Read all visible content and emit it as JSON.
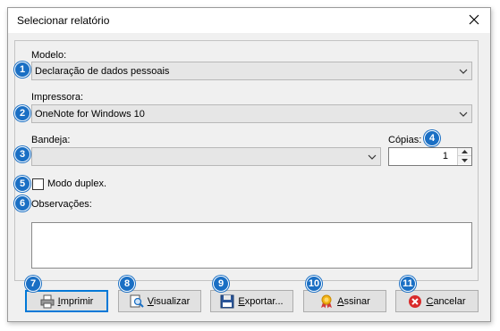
{
  "window": {
    "title": "Selecionar relatório"
  },
  "fields": {
    "modelo": {
      "label": "Modelo:",
      "value": "Declaração de dados pessoais"
    },
    "impressora": {
      "label": "Impressora:",
      "value": "OneNote for Windows 10"
    },
    "bandeja": {
      "label": "Bandeja:",
      "value": ""
    },
    "copias": {
      "label": "Cópias:",
      "value": "1"
    },
    "duplex": {
      "label": "Modo duplex.",
      "checked": false
    },
    "observacoes": {
      "label": "Observações:",
      "value": ""
    }
  },
  "buttons": {
    "imprimir": "Imprimir",
    "visualizar": "Visualizar",
    "exportar": "Exportar...",
    "assinar": "Assinar",
    "cancelar": "Cancelar"
  },
  "badges": [
    "1",
    "2",
    "3",
    "4",
    "5",
    "6",
    "7",
    "8",
    "9",
    "10",
    "11"
  ],
  "colors": {
    "badge": "#1a6fc4",
    "default_button_border": "#0078d7",
    "cancel_icon": "#d92b2b",
    "dialog_bg": "#f0f0f0"
  },
  "icons": {
    "close": "close-icon",
    "dropdown": "chevron-down-icon",
    "print": "printer-icon",
    "preview": "magnifier-icon",
    "export": "floppy-disk-icon",
    "sign": "ribbon-seal-icon",
    "cancel": "cancel-circle-icon"
  }
}
